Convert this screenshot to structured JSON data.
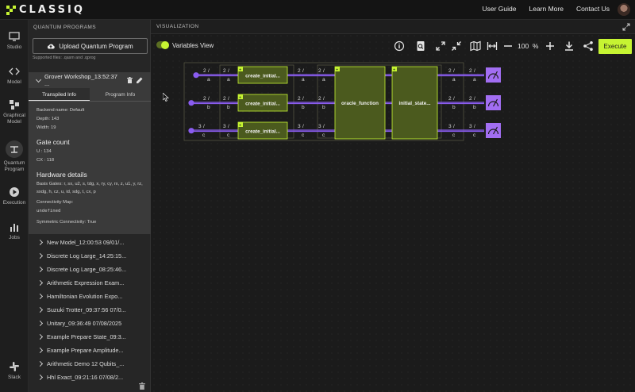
{
  "brand": {
    "name": "CLASSIQ",
    "accent": "#c6f432"
  },
  "topnav": {
    "items": [
      "User Guide",
      "Learn More",
      "Contact Us"
    ]
  },
  "rail": {
    "items": [
      {
        "label": "Studio",
        "icon": "monitor-icon"
      },
      {
        "label": "Model",
        "icon": "code-icon"
      },
      {
        "label": "Graphical Model",
        "icon": "graphical-model-icon"
      },
      {
        "label": "Quantum Program",
        "icon": "quantum-program-icon",
        "active": true
      },
      {
        "label": "Execution",
        "icon": "play-icon"
      },
      {
        "label": "Jobs",
        "icon": "bar-chart-icon"
      },
      {
        "label": "Slack",
        "icon": "slack-icon"
      }
    ]
  },
  "panel": {
    "title": "QUANTUM PROGRAMS",
    "upload_label": "Upload Quantum Program",
    "supported": "Supported files: .qasm and .qprog",
    "open_project": {
      "name": "Grover Workshop_13:52:37 ...",
      "tabs": [
        "Transpiled Info",
        "Program Info"
      ],
      "backend": "Backend name: Default",
      "depth": "Depth: 143",
      "width": "Width: 19",
      "gate_count_title": "Gate count",
      "u": "U : 134",
      "cx": "CX : 118",
      "hardware_title": "Hardware details",
      "basis_gates": "Basis Gates: r, sx, u2, s, tdg, x, ry, cy, rx, z, u1, y, rz, sxdg, h, cz, u, id, sdg, t, cx, p",
      "connectivity_label": "Connectivity Map:",
      "connectivity_value": "undefined",
      "symmetric": "Symmetric Connectivity: True"
    },
    "projects": [
      "New Model_12:00:53 09/01/...",
      "Discrete Log Large_14:25:15...",
      "Discrete Log Large_08:25:46...",
      "Arithmetic Expression Exam...",
      "Hamiltonian Evolution Expo...",
      "Suzuki Trotter_09:37:56 07/0...",
      "Unitary_09:36:49 07/08/2025",
      "Example Prepare State_09:3...",
      "Example Prepare Amplitude...",
      "Arithmetic Demo 12 Qubits_...",
      "Hhl Exact_09:21:16 07/08/2..."
    ]
  },
  "viz": {
    "title": "VISUALIZATION",
    "variables_view": "Variables View",
    "zoom": "100",
    "zoom_unit": "%",
    "execute_label": "Execute",
    "circuit": {
      "wires": [
        {
          "name": "a",
          "size": "2"
        },
        {
          "name": "b",
          "size": "2"
        },
        {
          "name": "c",
          "size": "3"
        }
      ],
      "blocks": [
        "create_initial...",
        "create_initial...",
        "create_initial...",
        "oracle_function",
        "initial_state..."
      ],
      "colors": {
        "wire": "#8a5cf0",
        "block": "#4b5a1e",
        "block_border": "#c6f432",
        "measure": "#a26ef2"
      }
    }
  }
}
